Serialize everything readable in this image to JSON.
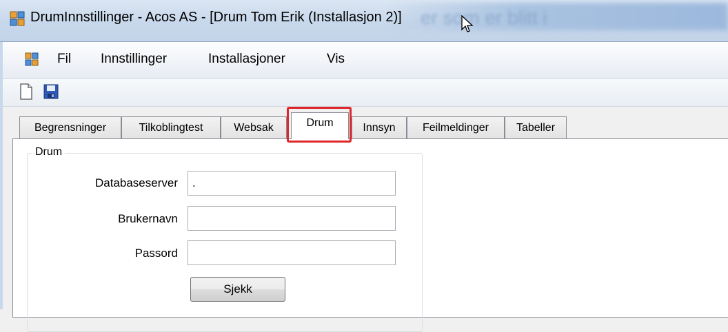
{
  "window": {
    "title": "DrumInnstillinger - Acos AS - [Drum Tom Erik (Installasjon 2)]",
    "background_blur_text": "er som er blitt i"
  },
  "menubar": {
    "items": [
      {
        "label": "Fil"
      },
      {
        "label": "Innstillinger"
      },
      {
        "label": "Installasjoner"
      },
      {
        "label": "Vis"
      }
    ]
  },
  "toolbar": {
    "buttons": [
      {
        "icon": "new-document-icon"
      },
      {
        "icon": "save-icon"
      }
    ]
  },
  "tabs": [
    {
      "label": "Begrensninger"
    },
    {
      "label": "Tilkoblingtest"
    },
    {
      "label": "Websak"
    },
    {
      "label": "Drum",
      "active": true
    },
    {
      "label": "Innsyn"
    },
    {
      "label": "Feilmeldinger"
    },
    {
      "label": "Tabeller"
    }
  ],
  "highlight_color": "#e0262b",
  "group": {
    "label": "Drum",
    "fields": [
      {
        "label": "Databaseserver",
        "value": "."
      },
      {
        "label": "Brukernavn",
        "value": ""
      },
      {
        "label": "Passord",
        "value": ""
      }
    ],
    "button_label": "Sjekk"
  }
}
